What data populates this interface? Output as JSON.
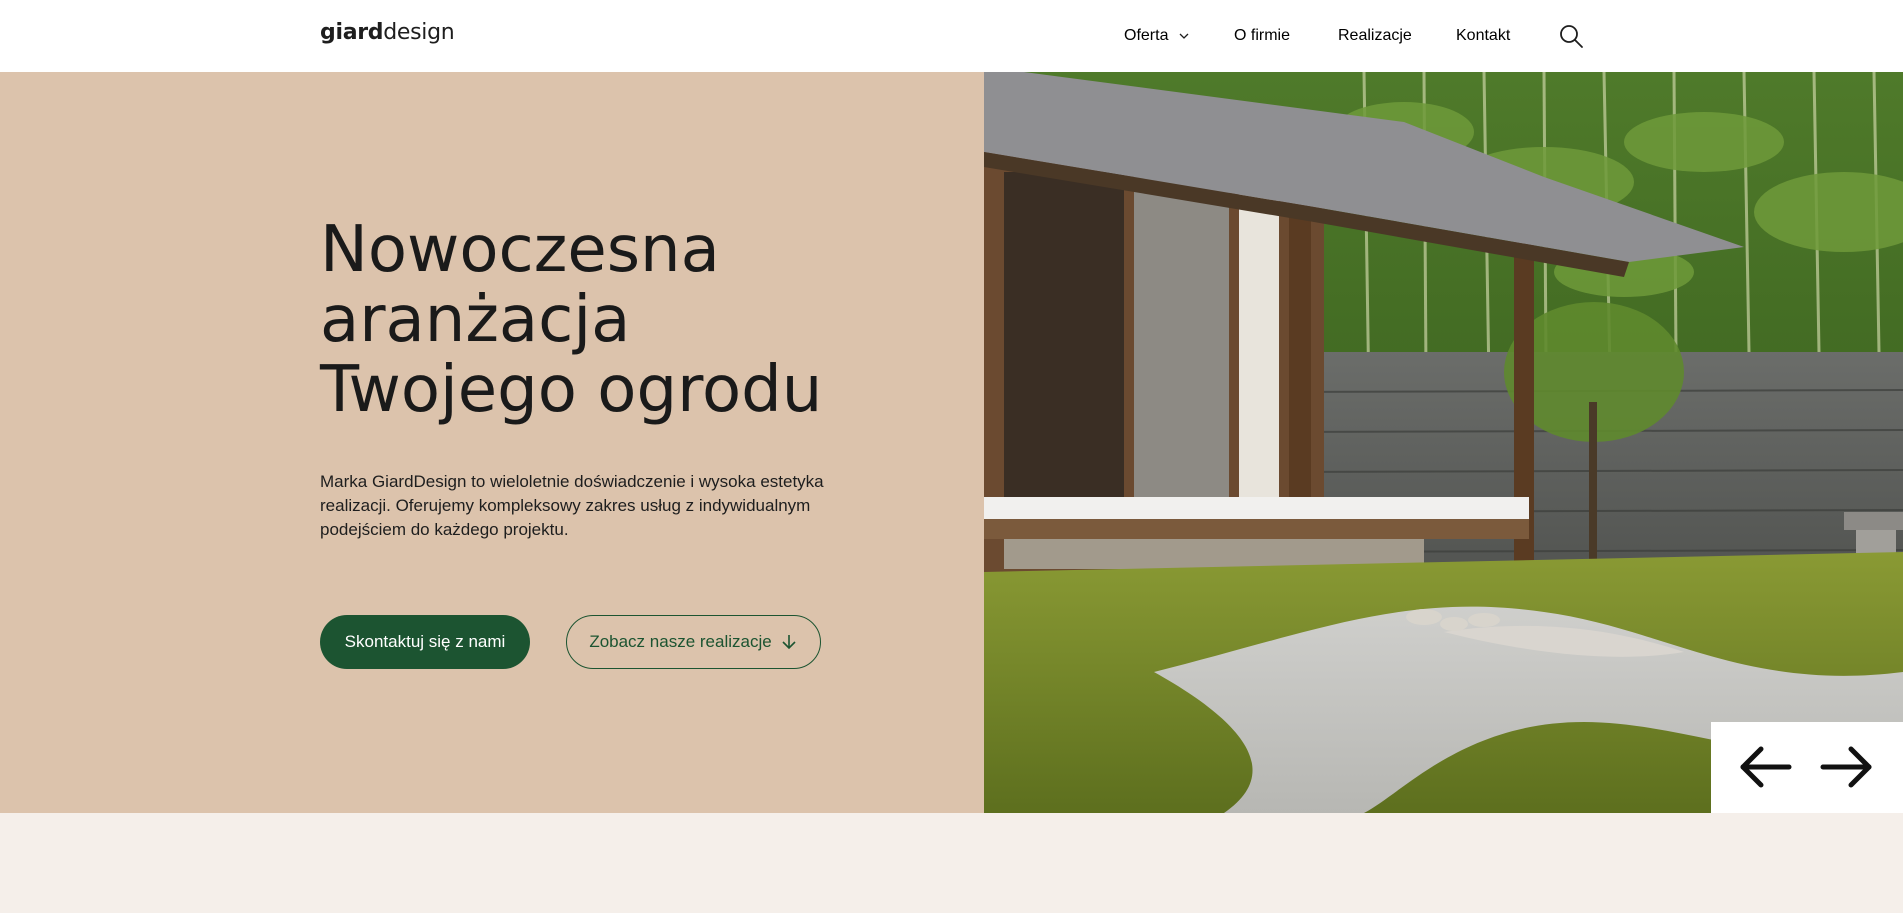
{
  "header": {
    "logo": {
      "bold": "giard",
      "light": "design"
    },
    "nav": [
      {
        "label": "Oferta",
        "has_dropdown": true
      },
      {
        "label": "O firmie"
      },
      {
        "label": "Realizacje"
      },
      {
        "label": "Kontakt"
      }
    ],
    "search_icon": "search-icon"
  },
  "hero": {
    "title_lines": [
      "Nowoczesna",
      "aranżacja",
      "Twojego ogrodu"
    ],
    "description": "Marka GiardDesign to wieloletnie doświadczenie i wysoka estetyka realizacji. Oferujemy kompleksowy zakres usług z indywidualnym podejściem do każdego projektu.",
    "primary_button": "Skontaktuj się z nami",
    "secondary_button": "Zobacz nasze realizacje",
    "image_icon": "japanese-garden-photo"
  },
  "slider": {
    "prev_icon": "arrow-left-icon",
    "next_icon": "arrow-right-icon"
  },
  "colors": {
    "hero_bg": "#dcc3ac",
    "accent_green": "#1c5431",
    "page_bg": "#f5efea",
    "text": "#1a1a1a"
  }
}
